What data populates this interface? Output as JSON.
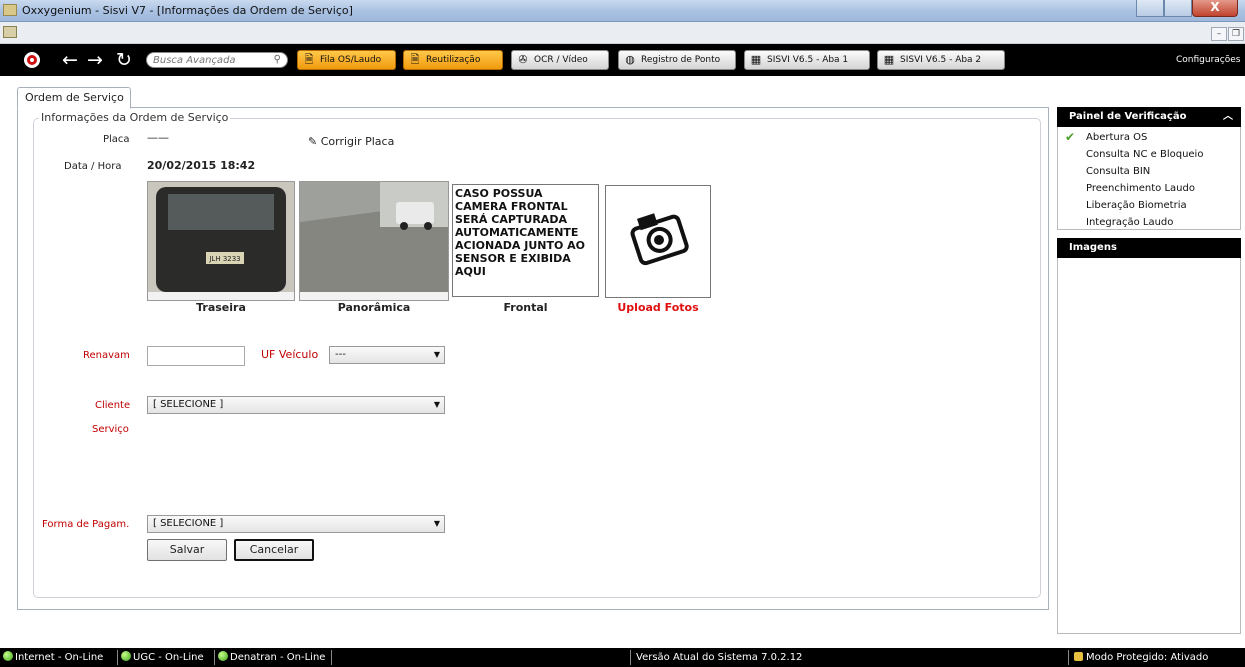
{
  "window": {
    "title": "Oxxygenium - Sisvi V7 - [Informações da Ordem de Serviço]",
    "close_label": "X",
    "mdi_min": "–",
    "mdi_restore": "❐"
  },
  "toolbar": {
    "search_placeholder": "Busca Avançada",
    "buttons": [
      {
        "label": "Fila OS/Laudo",
        "icon": "document-icon"
      },
      {
        "label": "Reutilização",
        "icon": "document-icon"
      },
      {
        "label": "OCR / Vídeo",
        "icon": "film-reel-icon"
      },
      {
        "label": "Registro de Ponto",
        "icon": "fingerprint-icon"
      },
      {
        "label": "SISVI V6.5 - Aba 1",
        "icon": "grid-icon"
      },
      {
        "label": "SISVI V6.5 - Aba 2",
        "icon": "grid-icon"
      }
    ],
    "config_label": "Configurações"
  },
  "tab": {
    "label": "Ordem de Serviço"
  },
  "form": {
    "legend": "Informações da Ordem de Serviço",
    "placa_label": "Placa",
    "placa_value": "——",
    "corrigir_label": "Corrigir Placa",
    "datahora_label": "Data / Hora",
    "datahora_value": "20/02/2015  18:42",
    "photos": {
      "traseira": "Traseira",
      "panoramica": "Panorâmica",
      "frontal": "Frontal",
      "frontal_text": "CASO POSSUA CAMERA FRONTAL SERÁ CAPTURADA AUTOMATICAMENTE ACIONADA JUNTO AO SENSOR E EXIBIDA AQUI",
      "upload": "Upload Fotos",
      "plate_text": "JLH 3233"
    },
    "renavam_label": "Renavam",
    "renavam_value": "",
    "uf_label": "UF Veículo",
    "uf_value": "---",
    "cliente_label": "Cliente",
    "cliente_value": "[ SELECIONE ]",
    "servico_label": "Serviço",
    "pagamento_label": "Forma de Pagam.",
    "pagamento_value": "[ SELECIONE ]",
    "salvar_label": "Salvar",
    "cancelar_label": "Cancelar"
  },
  "sidebar": {
    "title": "Painel de Verificação",
    "items": [
      {
        "label": "Abertura OS",
        "done": true
      },
      {
        "label": "Consulta NC e Bloqueio",
        "done": false
      },
      {
        "label": "Consulta BIN",
        "done": false
      },
      {
        "label": "Preenchimento Laudo",
        "done": false
      },
      {
        "label": "Liberação Biometria",
        "done": false
      },
      {
        "label": "Integração Laudo",
        "done": false
      }
    ],
    "images_title": "Imagens"
  },
  "status": {
    "internet": "Internet - On-Line",
    "ugc": "UGC - On-Line",
    "denatran": "Denatran - On-Line",
    "version": "Versão Atual do Sistema 7.0.2.12",
    "protected": "Modo Protegido: Ativado"
  },
  "colors": {
    "accent_orange": "#f5a623",
    "required_red": "#c00000",
    "check_green": "#4aa12a"
  }
}
